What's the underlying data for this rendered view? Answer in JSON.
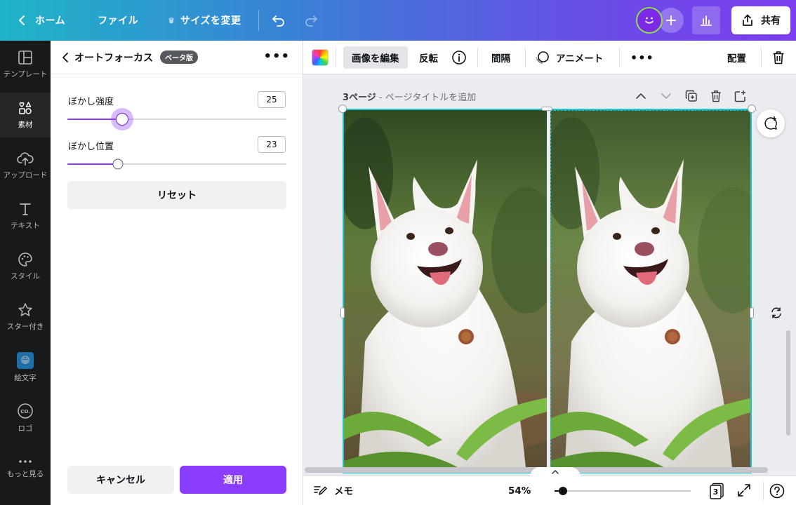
{
  "topbar": {
    "home_label": "ホーム",
    "file_label": "ファイル",
    "resize_label": "サイズを変更",
    "share_label": "共有",
    "add_collaborator_label": "+"
  },
  "rail": {
    "items": [
      {
        "label": "テンプレート",
        "icon": "template-icon"
      },
      {
        "label": "素材",
        "icon": "elements-icon",
        "active": true
      },
      {
        "label": "アップロード",
        "icon": "upload-cloud-icon"
      },
      {
        "label": "テキスト",
        "icon": "text-icon"
      },
      {
        "label": "スタイル",
        "icon": "palette-icon"
      },
      {
        "label": "スター付き",
        "icon": "star-icon"
      },
      {
        "label": "絵文字",
        "icon": "emoji-icon"
      },
      {
        "label": "ロゴ",
        "icon": "logo-icon"
      },
      {
        "label": "もっと見る",
        "icon": "more-dots-icon"
      }
    ],
    "logo_icon_text": "CO."
  },
  "panel": {
    "title": "オートフォーカス",
    "badge": "ベータ版",
    "controls": [
      {
        "label": "ぼかし強度",
        "value": "25",
        "fraction": 0.25
      },
      {
        "label": "ぼかし位置",
        "value": "23",
        "fraction": 0.23
      }
    ],
    "reset_label": "リセット",
    "cancel_label": "キャンセル",
    "apply_label": "適用"
  },
  "toolbar": {
    "edit_image_label": "画像を編集",
    "flip_label": "反転",
    "spacing_label": "間隔",
    "animate_label": "アニメート",
    "position_label": "配置"
  },
  "canvas": {
    "page_number_label": "3ページ",
    "page_separator": " - ",
    "page_title_placeholder": "ページタイトルを追加"
  },
  "bottombar": {
    "notes_label": "メモ",
    "zoom_label": "54%",
    "zoom_fraction": 0.13,
    "page_count": "3"
  },
  "colors": {
    "accent_purple": "#8b3dff",
    "selection_cyan": "#22c4d3",
    "rail_bg": "#18191b"
  }
}
